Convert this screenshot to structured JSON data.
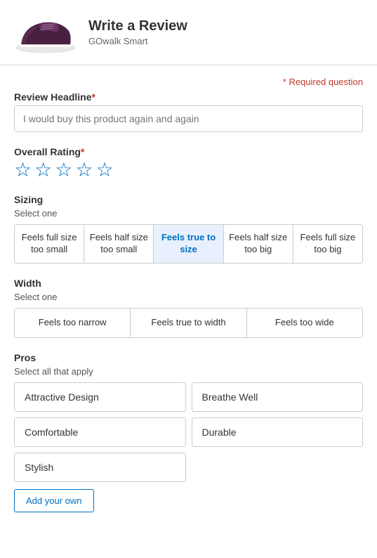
{
  "header": {
    "title": "Write a Review",
    "subtitle": "GOwalk Smart"
  },
  "required_note": "* Required question",
  "review_headline": {
    "label": "Review Headline",
    "placeholder": "I would buy this product again and again"
  },
  "overall_rating": {
    "label": "Overall Rating",
    "stars": [
      "☆",
      "☆",
      "☆",
      "☆",
      "☆"
    ]
  },
  "sizing": {
    "label": "Sizing",
    "sublabel": "Select one",
    "options": [
      "Feels full size too small",
      "Feels half size too small",
      "Feels true to size",
      "Feels half size too big",
      "Feels full size too big"
    ],
    "selected_index": 2
  },
  "width": {
    "label": "Width",
    "sublabel": "Select one",
    "options": [
      "Feels too narrow",
      "Feels true to width",
      "Feels too wide"
    ]
  },
  "pros": {
    "label": "Pros",
    "sublabel": "Select all that apply",
    "items": [
      "Attractive Design",
      "Breathe Well",
      "Comfortable",
      "Durable",
      "Stylish"
    ],
    "add_button": "Add your own"
  }
}
